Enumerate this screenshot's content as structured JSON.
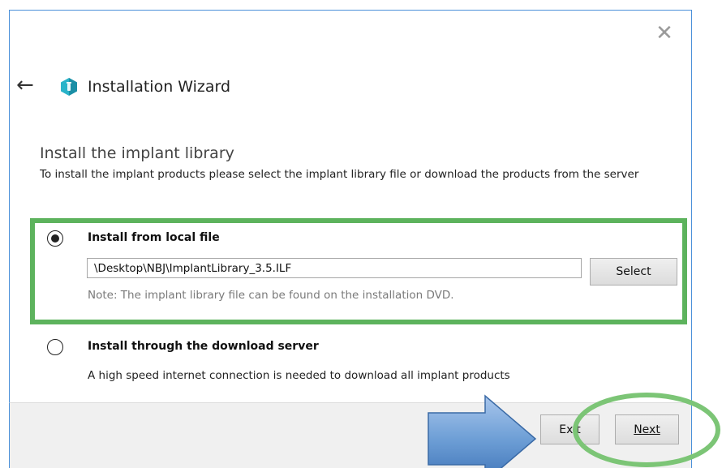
{
  "window": {
    "title": "Installation Wizard",
    "close_icon": "close-icon",
    "back_icon": "back-arrow-icon"
  },
  "content": {
    "heading": "Install the implant library",
    "description": "To install the implant products please select the implant library file or download the products from the server"
  },
  "options": {
    "local": {
      "label": "Install from local file",
      "selected": true,
      "path_value": "\\Desktop\\NBJ\\ImplantLibrary_3.5.ILF",
      "select_label": "Select",
      "note": "Note: The implant library file can be found on the installation DVD."
    },
    "server": {
      "label": "Install through the download server",
      "selected": false,
      "info": "A high speed internet connection is needed to download all implant products"
    }
  },
  "footer": {
    "exit_label": "Exit",
    "next_label": "Next"
  },
  "colors": {
    "highlight_green": "#5db35d",
    "arrow_blue": "#6e9fd6",
    "window_border": "#4a90d9"
  }
}
